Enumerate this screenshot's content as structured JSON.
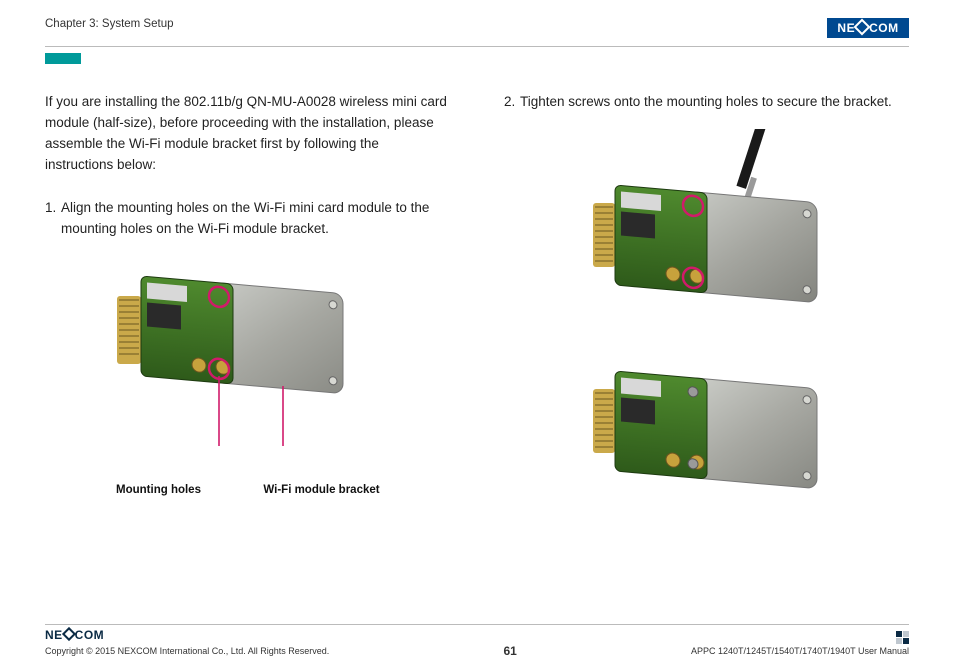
{
  "brand": "NEXCOM",
  "header": {
    "chapter": "Chapter 3: System Setup"
  },
  "left": {
    "intro": "If you are installing the 802.11b/g QN-MU-A0028 wireless mini card module (half-size), before proceeding with the installation, please assemble the Wi-Fi module bracket first by following the instructions below:",
    "step1_num": "1.",
    "step1_text": "Align the mounting holes on the Wi-Fi mini card module to the mounting holes on the Wi-Fi module bracket.",
    "label_holes": "Mounting holes",
    "label_bracket": "Wi-Fi module bracket"
  },
  "right": {
    "step2_num": "2.",
    "step2_text": "Tighten screws onto the mounting holes to secure the bracket."
  },
  "footer": {
    "copyright": "Copyright © 2015 NEXCOM International Co., Ltd. All Rights Reserved.",
    "page": "61",
    "doc": "APPC 1240T/1245T/1540T/1740T/1940T User Manual"
  }
}
